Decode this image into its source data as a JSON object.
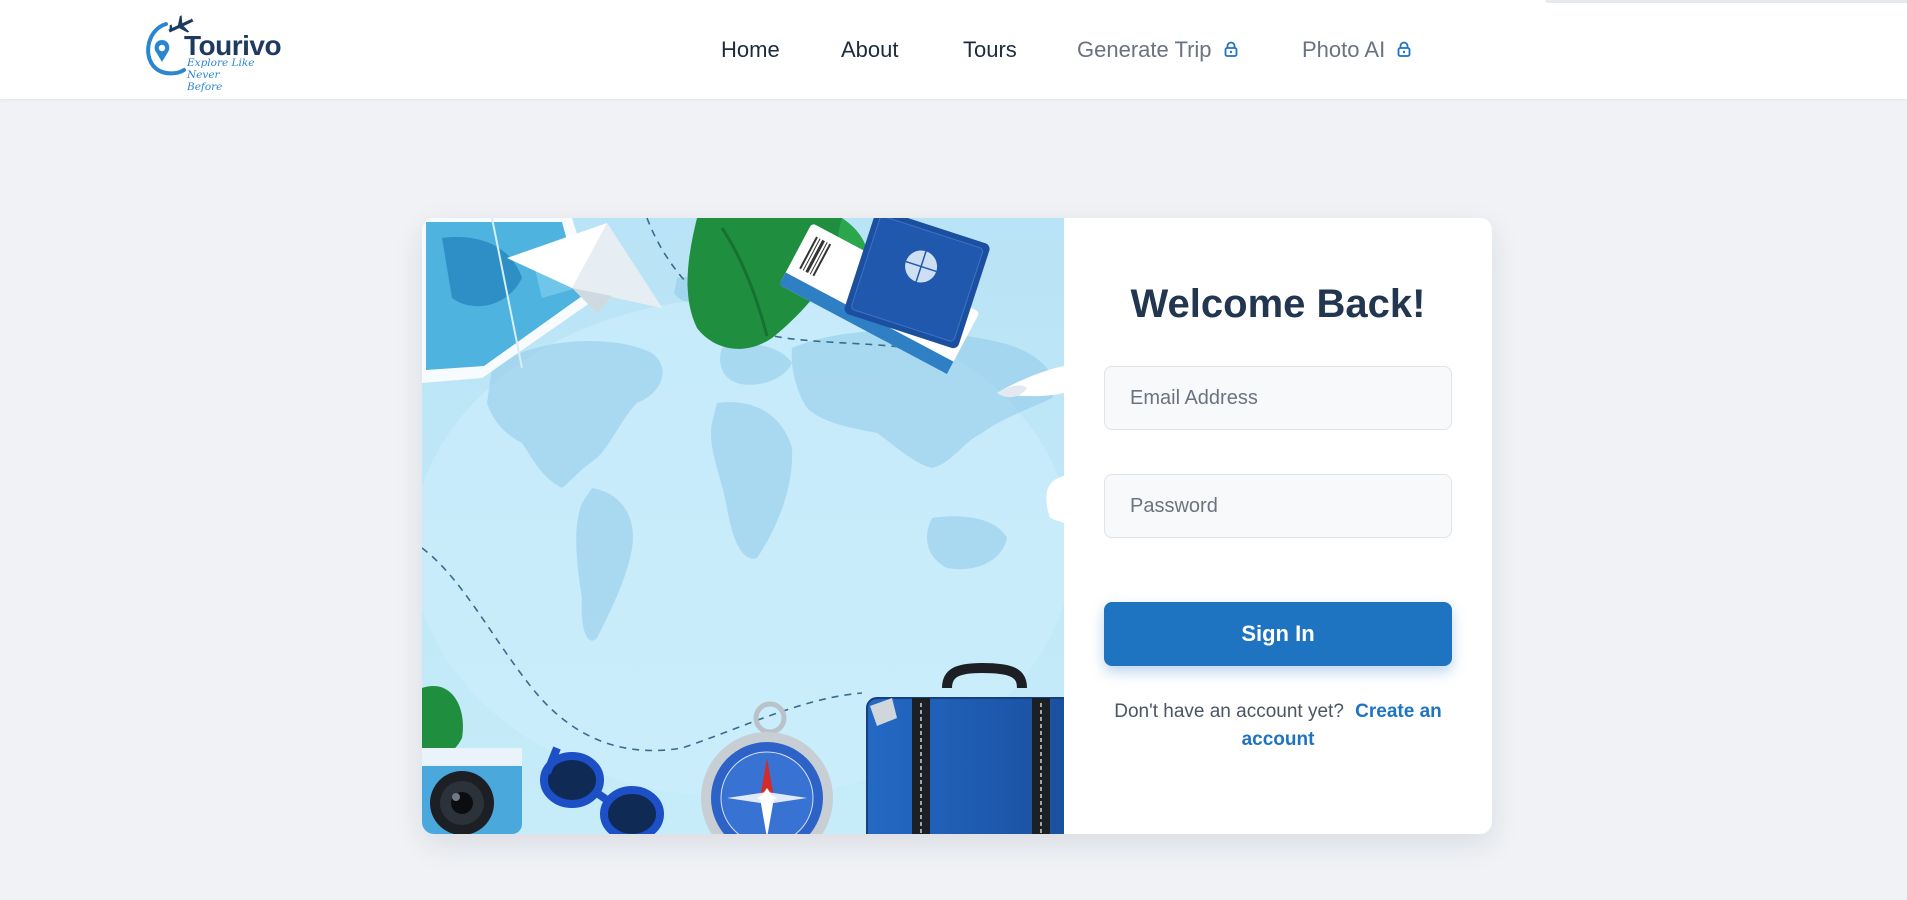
{
  "brand": {
    "name": "Tourivo",
    "tagline": "Explore Like Never Before"
  },
  "nav": {
    "home": "Home",
    "about": "About",
    "tours": "Tours",
    "generate_trip": "Generate Trip",
    "photo_ai": "Photo AI"
  },
  "login": {
    "title": "Welcome Back!",
    "email_placeholder": "Email Address",
    "password_placeholder": "Password",
    "signin_label": "Sign In",
    "no_account_text": "Don't have an account yet?",
    "create_account_label": "Create an account"
  },
  "colors": {
    "accent": "#1f74c2",
    "heading": "#22364f",
    "page_bg": "#f0f2f5"
  },
  "icons": {
    "lock": "lock-icon",
    "logo_plane": "airplane-icon",
    "logo_pin": "map-pin-icon"
  }
}
